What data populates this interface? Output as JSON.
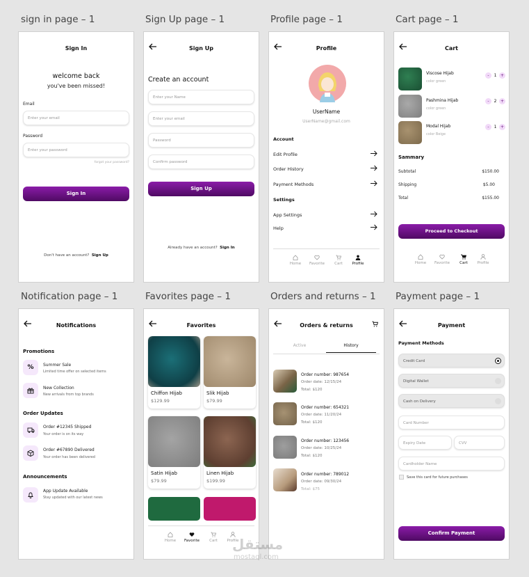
{
  "labels": [
    "sign in page – 1",
    "Sign Up page – 1",
    "Profile page – 1",
    "Cart page – 1",
    "Notification page – 1",
    "Favorites page – 1",
    "Orders and returns – 1",
    "Payment page – 1"
  ],
  "signin": {
    "title": "Sign In",
    "welcome": "welcome back",
    "missed": "you've been missed!",
    "email_label": "Email",
    "email_ph": "Enter your email",
    "password_label": "Password",
    "password_ph": "Enter your password",
    "forgot": "forgot your password?",
    "button": "Sign In",
    "no_account": "Don't have an account?",
    "signup_link": "Sign Up"
  },
  "signup": {
    "title": "Sign Up",
    "heading": "Create an account",
    "name_ph": "Enter your Name",
    "email_ph": "Enter your email",
    "password_ph": "Password",
    "confirm_ph": "Confirm password",
    "button": "Sign Up",
    "have_account": "Already have an account?",
    "signin_link": "Sign In"
  },
  "profile": {
    "title": "Profile",
    "username": "UserName",
    "email": "UserName@gmail.com",
    "account_section": "Account",
    "items": [
      "Edit Profile",
      "Order History",
      "Payment Methods"
    ],
    "settings_section": "Settings",
    "settings_items": [
      "App Settings",
      "Help"
    ]
  },
  "nav": {
    "home": "Home",
    "favorite": "Favorite",
    "cart": "Cart",
    "profile": "Profile"
  },
  "cart": {
    "title": "Cart",
    "items": [
      {
        "name": "Viscose Hijab",
        "color": "color green",
        "qty": "1"
      },
      {
        "name": "Pashmina Hijab",
        "color": "color green",
        "qty": "2"
      },
      {
        "name": "Modal Hijab",
        "color": "color Beige",
        "qty": "1"
      }
    ],
    "summary": "Sammary",
    "subtotal_label": "Subtotal",
    "subtotal": "$150.00",
    "shipping_label": "Shipping",
    "shipping": "$5.00",
    "total_label": "Total",
    "total": "$155.00",
    "button": "Proceed to Checkout",
    "minus": "-",
    "plus": "+"
  },
  "notif": {
    "title": "Notifications",
    "promotions": "Promotions",
    "p1_title": "Summer Sale",
    "p1_desc": "Limited time offer on selected items",
    "p2_title": "New Collection",
    "p2_desc": "New arrivals from top brands",
    "order_updates": "Order Updates",
    "o1_title": "Order #12345 Shipped",
    "o1_desc": "Your order is on its way",
    "o2_title": "Order #67890 Delivered",
    "o2_desc": "Your order has been delivered",
    "announcements": "Announcements",
    "a1_title": "App Update Available",
    "a1_desc": "Stay updated with our latest news"
  },
  "fav": {
    "title": "Favorites",
    "items": [
      {
        "name": "Chiffon Hijab",
        "price": "$129.99"
      },
      {
        "name": "Slik Hijab",
        "price": "$79.99"
      },
      {
        "name": "Satin Hijab",
        "price": "$79.99"
      },
      {
        "name": "Linen Hijab",
        "price": "$199.99"
      }
    ]
  },
  "orders": {
    "title": "Orders & returns",
    "tab_active": "Active",
    "tab_history": "History",
    "items": [
      {
        "number": "Order number: 987654",
        "date": "Order date: 12/15/24",
        "total": "Total: $120"
      },
      {
        "number": "Order number: 654321",
        "date": "Order date: 11/20/24",
        "total": "Total: $120"
      },
      {
        "number": "Order number: 123456",
        "date": "Order date: 10/25/24",
        "total": "Total: $120"
      },
      {
        "number": "Order number: 789012",
        "date": "Order date: 09/30/24",
        "total": "Total: $75"
      }
    ]
  },
  "payment": {
    "title": "Payment",
    "methods": "Payment Methods",
    "m1": "Credit Card",
    "m2": "Digital Wallet",
    "m3": "Cash on Delivery",
    "card_number": "Card Number",
    "expiry": "Expiry Date",
    "cvv": "CVV",
    "holder": "Cardholder Name",
    "save": "Save this card for future purchases",
    "button": "Confirm Payment"
  },
  "watermark": {
    "ar": "مستقل",
    "en": "mostaql.com"
  }
}
